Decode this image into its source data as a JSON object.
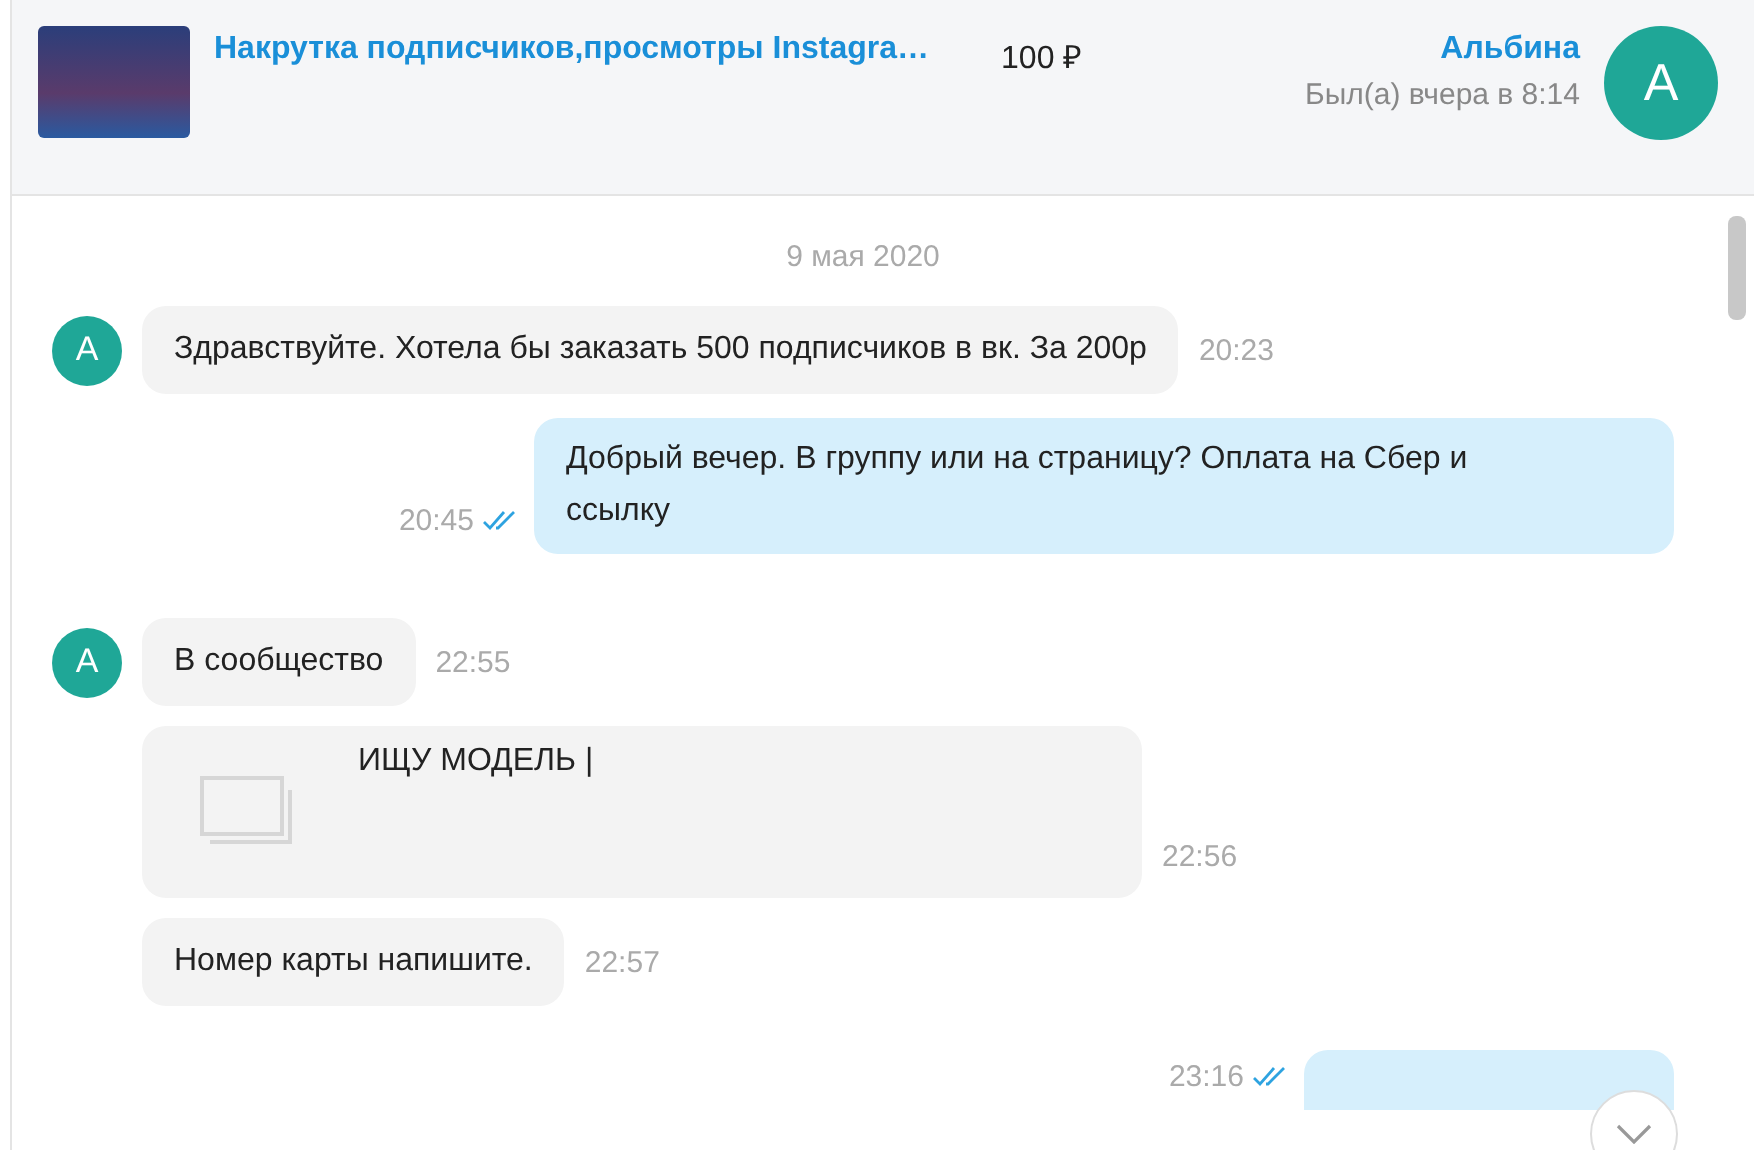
{
  "header": {
    "listing_title": "Накрутка подписчиков,просмотры Instagra…",
    "price": "100 ₽",
    "contact_name": "Альбина",
    "last_seen": "Был(а) вчера в 8:14",
    "avatar_letter": "А"
  },
  "date": "9 мая 2020",
  "messages": [
    {
      "kind": "incoming",
      "avatar_letter": "А",
      "text": "Здравствуйте. Хотела бы заказать 500 подписчиков в вк. За 200р",
      "time": "20:23"
    },
    {
      "kind": "outgoing",
      "text": "Добрый вечер. В группу или на страницу? Оплата на Сбер и ссылку",
      "time": "20:45",
      "read": true
    },
    {
      "kind": "incoming",
      "avatar_letter": "А",
      "text": "В сообщество",
      "time": "22:55"
    },
    {
      "kind": "link",
      "text": "ИЩУ МОДЕЛЬ |",
      "time": "22:56"
    },
    {
      "kind": "incoming",
      "text": "Номер карты напишите.",
      "time": "22:57"
    },
    {
      "kind": "outgoing",
      "time": "23:16",
      "read": true
    }
  ]
}
